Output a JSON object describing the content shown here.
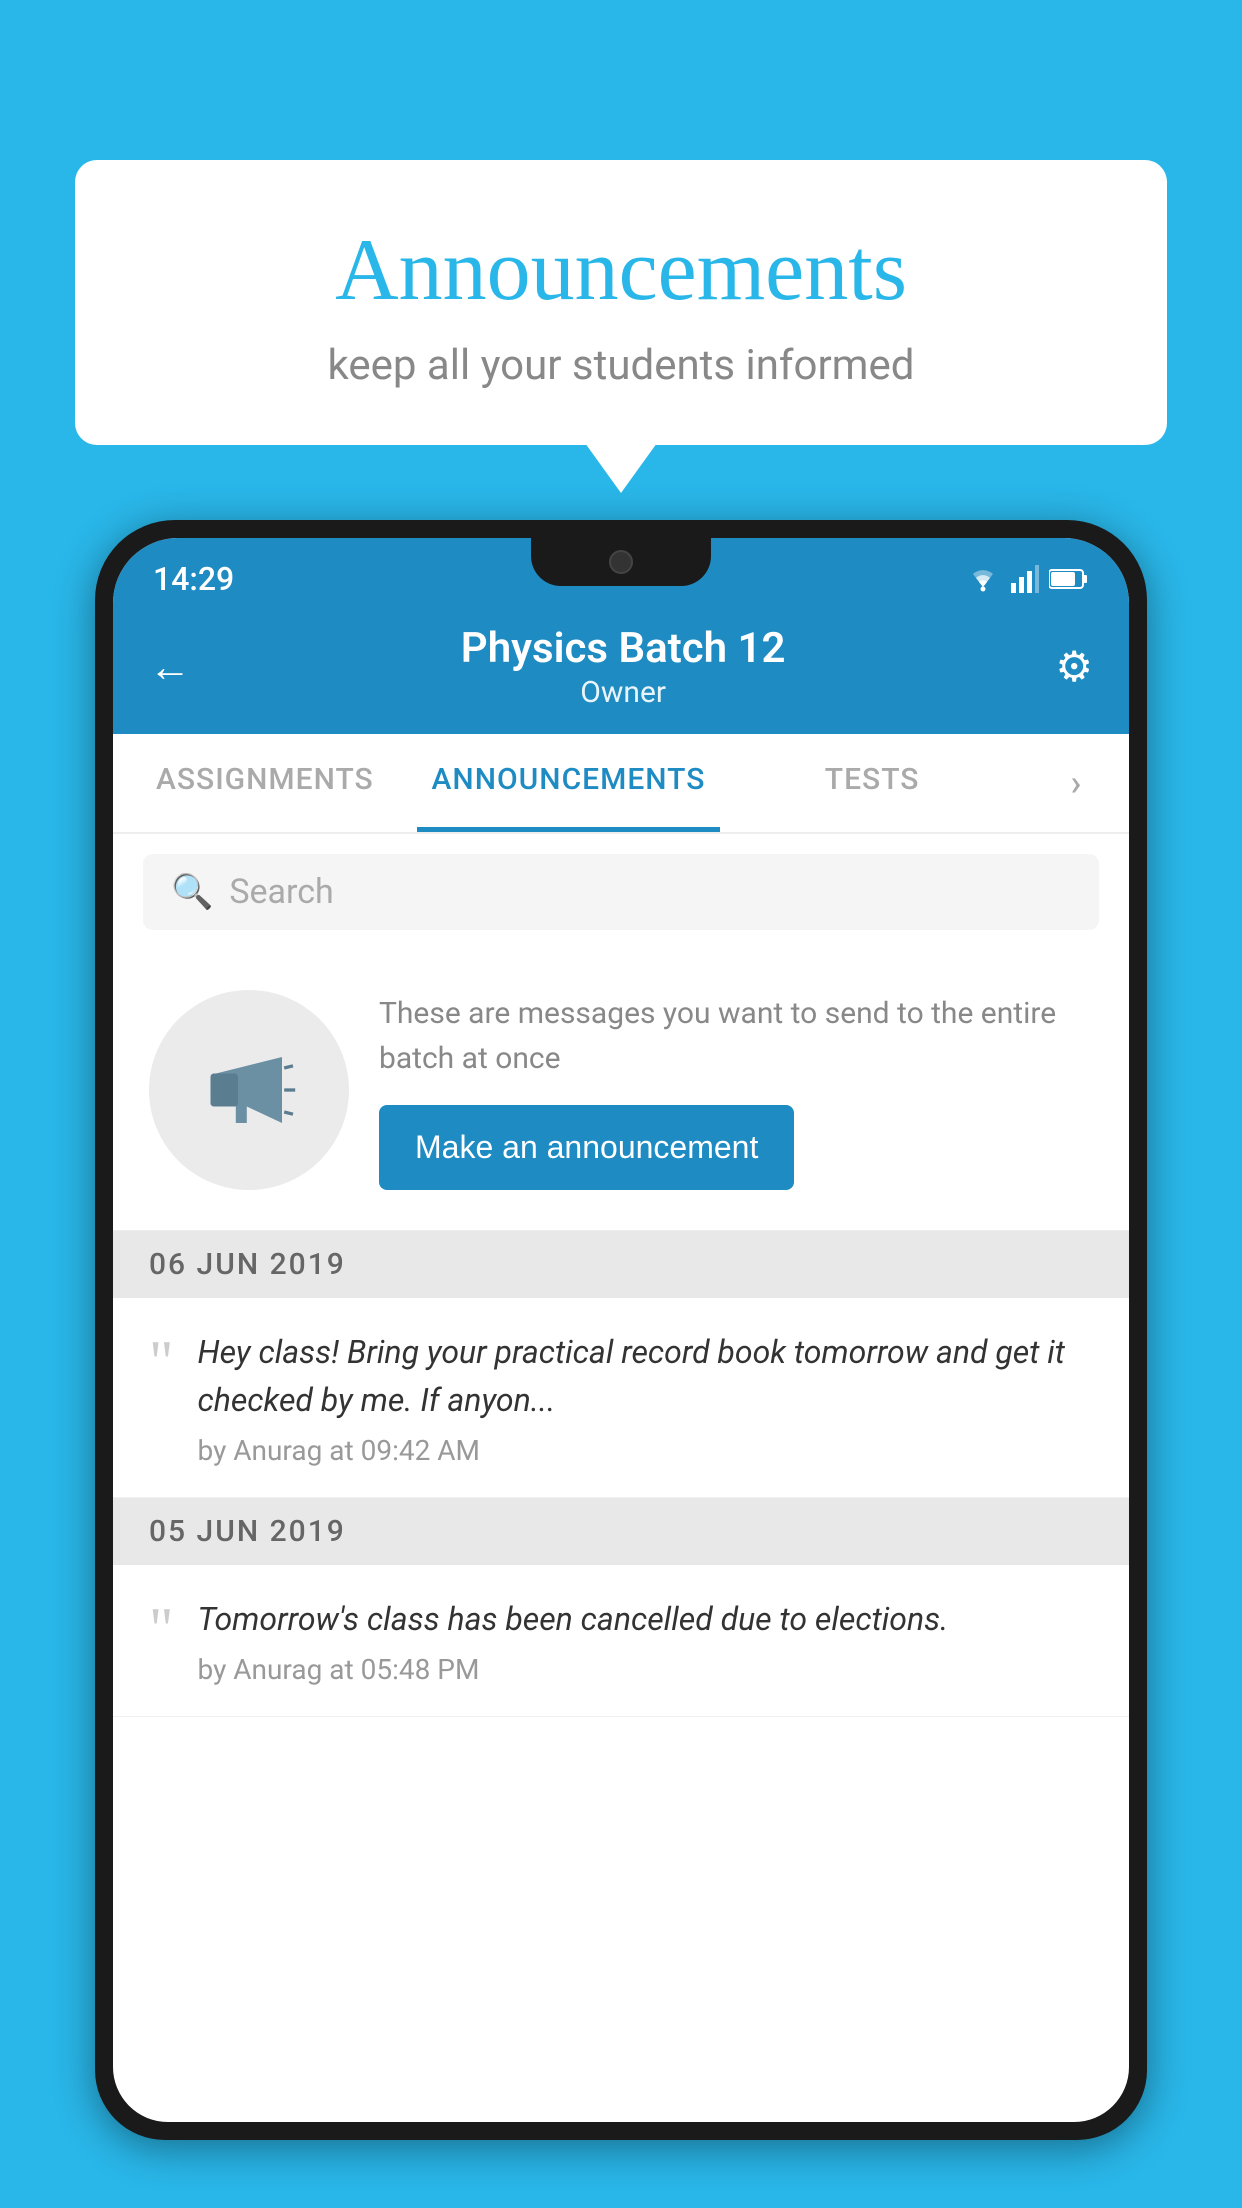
{
  "background_color": "#29b6e8",
  "speech_bubble": {
    "title": "Announcements",
    "subtitle": "keep all your students informed"
  },
  "status_bar": {
    "time": "14:29"
  },
  "header": {
    "title": "Physics Batch 12",
    "subtitle": "Owner",
    "back_label": "←",
    "gear_label": "⚙"
  },
  "tabs": [
    {
      "label": "ASSIGNMENTS",
      "active": false
    },
    {
      "label": "ANNOUNCEMENTS",
      "active": true
    },
    {
      "label": "TESTS",
      "active": false
    },
    {
      "label": "›",
      "active": false
    }
  ],
  "search": {
    "placeholder": "Search"
  },
  "promo": {
    "description": "These are messages you want to send to the entire batch at once",
    "button_label": "Make an announcement"
  },
  "announcements": [
    {
      "date": "06  JUN  2019",
      "text": "Hey class! Bring your practical record book tomorrow and get it checked by me. If anyon...",
      "meta": "by Anurag at 09:42 AM"
    },
    {
      "date": "05  JUN  2019",
      "text": "Tomorrow's class has been cancelled due to elections.",
      "meta": "by Anurag at 05:48 PM"
    }
  ]
}
